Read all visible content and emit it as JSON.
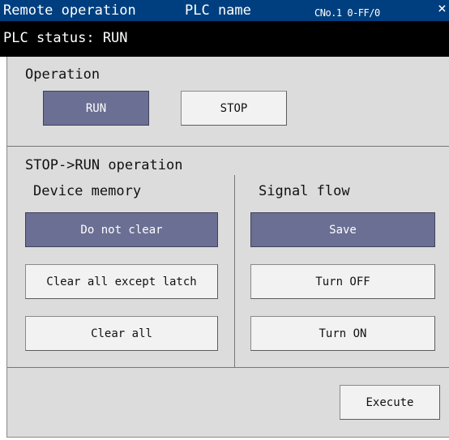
{
  "titlebar": {
    "title": "Remote operation",
    "plc_name_label": "PLC name",
    "connection": "CNo.1 0-FF/0",
    "close_glyph": "×"
  },
  "status": {
    "text": "PLC status: RUN"
  },
  "operation": {
    "label": "Operation",
    "run_label": "RUN",
    "stop_label": "STOP",
    "selected": "RUN"
  },
  "stop_run": {
    "label": "STOP->RUN operation",
    "device_memory": {
      "label": "Device memory",
      "options": [
        "Do not clear",
        "Clear all except latch",
        "Clear all"
      ],
      "selected": "Do not clear"
    },
    "signal_flow": {
      "label": "Signal flow",
      "options": [
        "Save",
        "Turn OFF",
        "Turn ON"
      ],
      "selected": "Save"
    }
  },
  "actions": {
    "execute_label": "Execute"
  },
  "colors": {
    "titlebar_bg": "#003f7f",
    "statusbar_bg": "#000000",
    "panel_bg": "#dcdcdc",
    "selected_button_bg": "#6b6f93"
  },
  "icons": {
    "close": "close-icon"
  }
}
